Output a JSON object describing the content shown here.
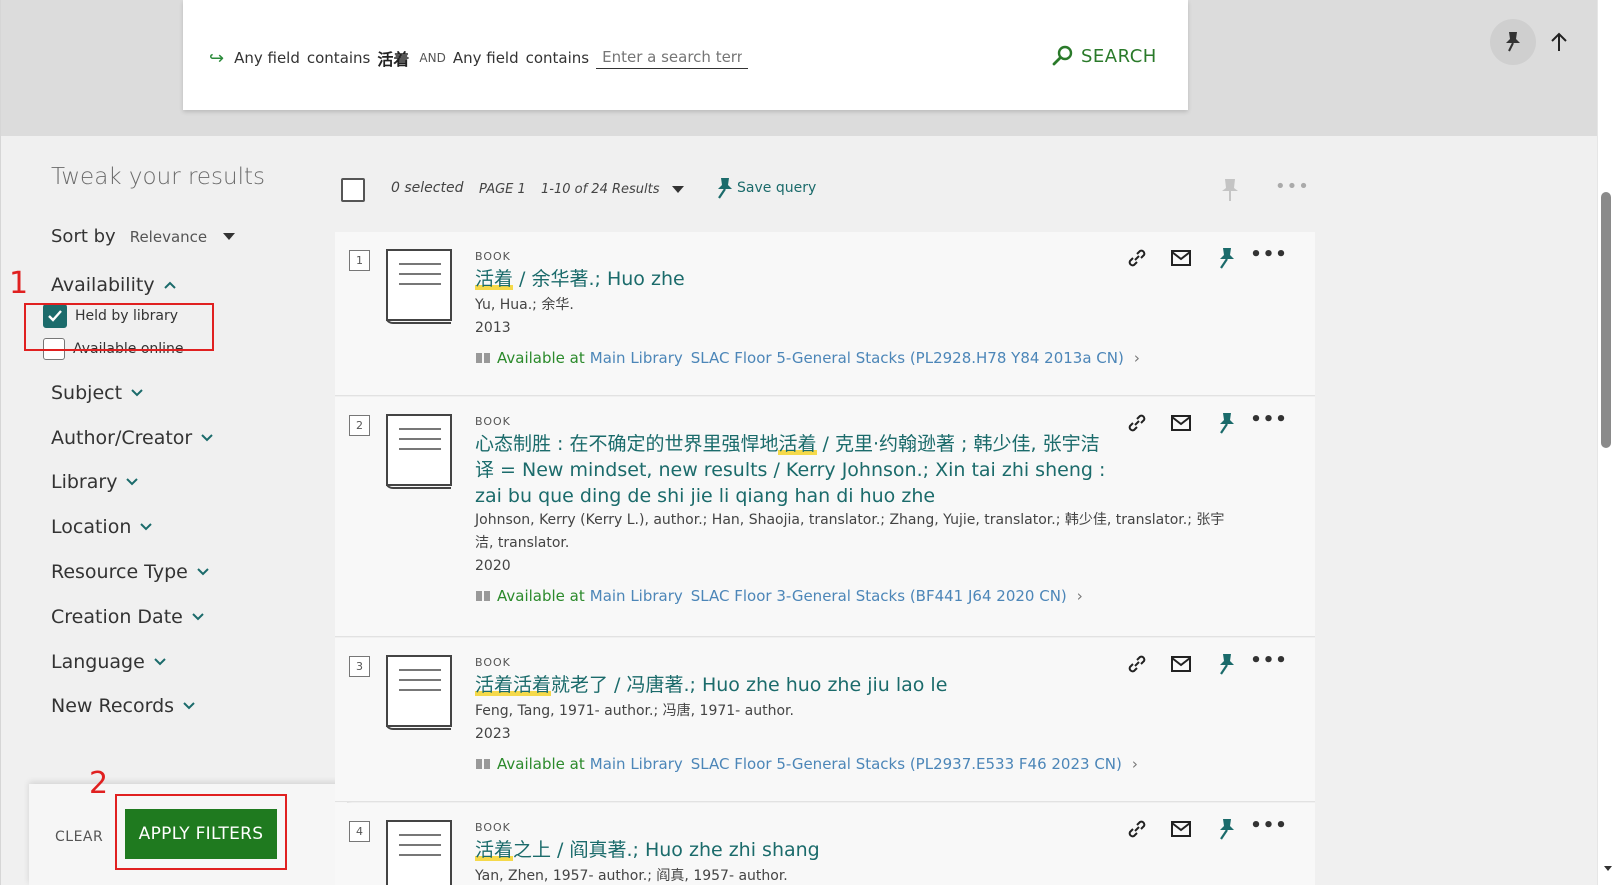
{
  "search": {
    "row1_field": "Any field",
    "row1_op": "contains",
    "row1_term": "活着",
    "bool": "AND",
    "row2_field": "Any field",
    "row2_op": "contains",
    "row2_placeholder": "Enter a search term",
    "button": "SEARCH"
  },
  "sidebar": {
    "title": "Tweak your results",
    "sort_label": "Sort by",
    "sort_value": "Relevance",
    "availability": {
      "label": "Availability",
      "options": [
        {
          "label": "Held by library",
          "checked": true
        },
        {
          "label": "Available online",
          "checked": false
        }
      ]
    },
    "facets": [
      "Subject",
      "Author/Creator",
      "Library",
      "Location",
      "Resource Type",
      "Creation Date",
      "Language",
      "New Records"
    ],
    "clear": "CLEAR",
    "apply": "APPLY FILTERS"
  },
  "annotations": {
    "one": "1",
    "two": "2",
    "color": "#e02020"
  },
  "toolbar": {
    "selected": "0 selected",
    "page": "PAGE 1",
    "range": "1-10 of 24 Results",
    "save_query": "Save query"
  },
  "results": [
    {
      "num": "1",
      "type": "BOOK",
      "title_hl": "活着",
      "title_rest": " / 余华著.; Huo zhe",
      "meta": [
        "Yu, Hua.; 余华.",
        "2013"
      ],
      "avail": "Available at",
      "library": "Main Library",
      "location": "SLAC Floor 5-General Stacks (PL2928.H78 Y84 2013a CN)"
    },
    {
      "num": "2",
      "type": "BOOK",
      "title_pre": "心态制胜 : 在不确定的世界里强悍地",
      "title_hl": "活着",
      "title_rest": " / 克里·约翰逊著 ; 韩少佳, 张宇洁译 = New mindset, new results / Kerry Johnson.; Xin tai zhi sheng : zai bu que ding de shi jie li qiang han di huo zhe",
      "meta": [
        "Johnson, Kerry (Kerry L.), author.; Han, Shaojia, translator.; Zhang, Yujie, translator.; 韩少佳, translator.; 张宇洁, translator.",
        "2020"
      ],
      "avail": "Available at",
      "library": "Main Library",
      "location": "SLAC Floor 3-General Stacks (BF441 J64 2020 CN)"
    },
    {
      "num": "3",
      "type": "BOOK",
      "title_hl": "活着活着",
      "title_rest": "就老了 / 冯唐著.; Huo zhe huo zhe jiu lao le",
      "meta": [
        "Feng, Tang, 1971- author.; 冯唐, 1971- author.",
        "2023"
      ],
      "avail": "Available at",
      "library": "Main Library",
      "location": "SLAC Floor 5-General Stacks (PL2937.E533 F46 2023 CN)"
    },
    {
      "num": "4",
      "type": "BOOK",
      "title_hl": "活着",
      "title_rest": "之上 / 阎真著.; Huo zhe zhi shang",
      "meta": [
        "Yan, Zhen, 1957- author.; 阎真, 1957- author."
      ]
    }
  ],
  "colors": {
    "teal": "#1b6b6b",
    "green": "#2b8a2b",
    "link_blue": "#4c86b8",
    "apply_green": "#1f7a1f"
  }
}
